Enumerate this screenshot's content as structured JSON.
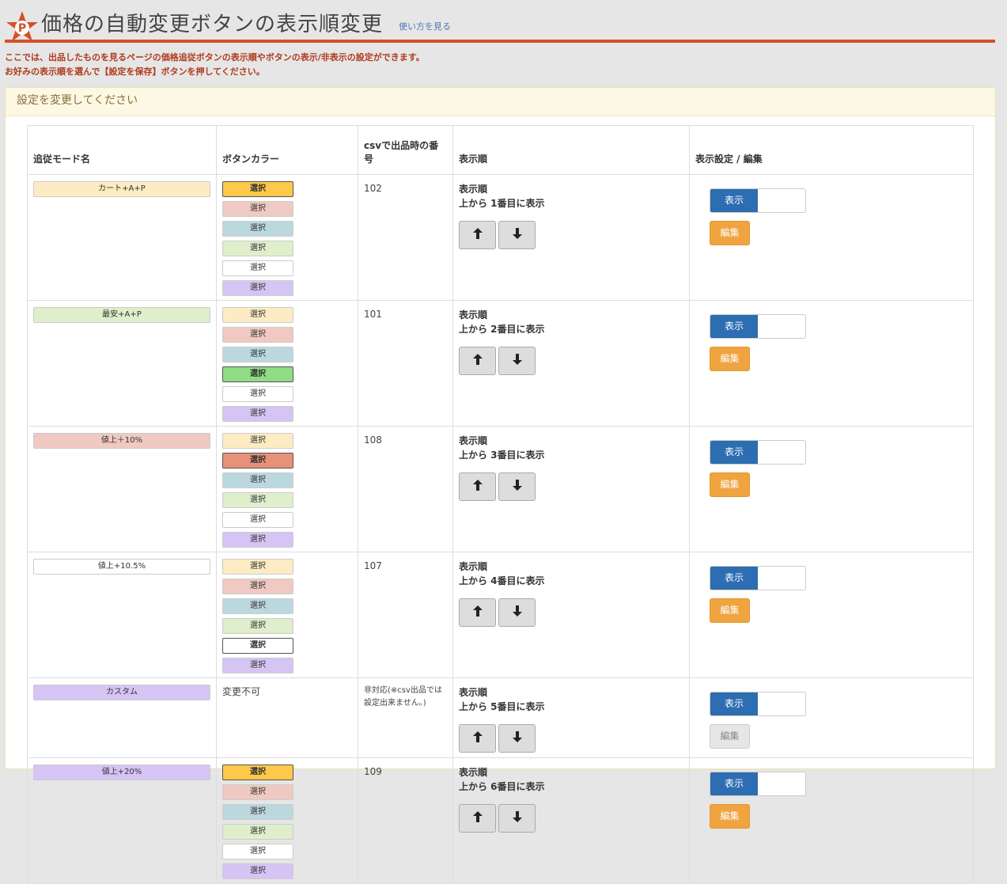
{
  "header": {
    "title": "価格の自動変更ボタンの表示順変更",
    "howto_link": "使い方を見る",
    "logo_letter": "P"
  },
  "notice": {
    "line1": "ここでは、出品したものを見るページの価格追従ボタンの表示順やボタンの表示/非表示の設定ができます。",
    "line2": "お好みの表示順を選んで【設定を保存】ボタンを押してください。"
  },
  "panel": {
    "heading": "設定を変更してください"
  },
  "table": {
    "headers": {
      "mode": "追従モード名",
      "color": "ボタンカラー",
      "csv": "csvで出品時の番号",
      "order": "表示順",
      "actions": "表示設定 / 編集"
    },
    "order_label": "表示順",
    "show_label": "表示",
    "edit_label": "編集",
    "select_label": "選択",
    "palette": [
      "#fdecc3",
      "#f0c9c2",
      "#bcd8df",
      "#dfeecb",
      "#ffffff",
      "#d6c4f4"
    ],
    "selected_palette": [
      "#fec94a",
      "#e79179",
      "#8fc6d3",
      "#8fdc84",
      "#ffffff",
      "#dab8ee"
    ],
    "rows": [
      {
        "mode": "カート+A+P",
        "mode_color": "#fdecc3",
        "selected": 0,
        "csv": "102",
        "order": "上から 1番目に表示",
        "edit_enabled": true
      },
      {
        "mode": "最安+A+P",
        "mode_color": "#dfeecb",
        "selected": 3,
        "csv": "101",
        "order": "上から 2番目に表示",
        "edit_enabled": true
      },
      {
        "mode": "値上＋10%",
        "mode_color": "#f0c9c2",
        "selected": 1,
        "csv": "108",
        "order": "上から 3番目に表示",
        "edit_enabled": true
      },
      {
        "mode": "値上+10.5%",
        "mode_color": "#ffffff",
        "selected": 4,
        "csv": "107",
        "order": "上から 4番目に表示",
        "edit_enabled": true
      },
      {
        "mode": "カスタム",
        "mode_color": "#d6c4f4",
        "fixed_color": "変更不可",
        "csv": "非対応(※csv出品では設定出来ません。)",
        "order": "上から 5番目に表示",
        "edit_enabled": false
      },
      {
        "mode": "値上+20%",
        "mode_color": "#d6c4f4",
        "selected": 0,
        "csv": "109",
        "order": "上から 6番目に表示",
        "edit_enabled": true
      }
    ]
  },
  "colors": {
    "accent": "#d2502a",
    "notice": "#b03a1c",
    "primary": "#2d6db1",
    "warning": "#efa440"
  }
}
